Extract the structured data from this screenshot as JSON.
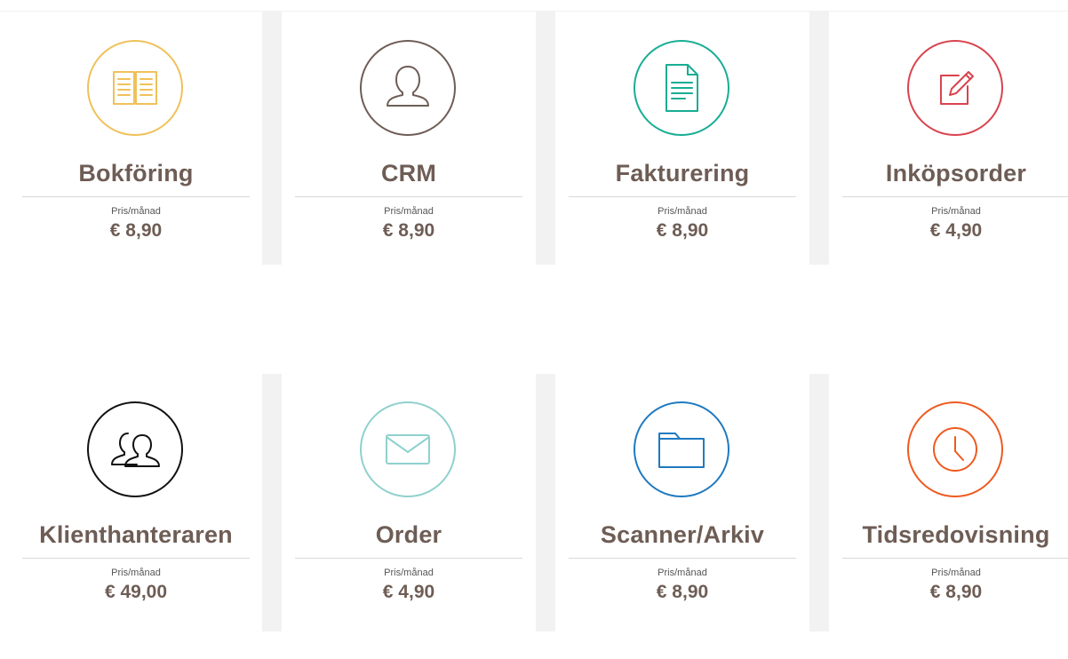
{
  "price_label": "Pris/månad",
  "modules": [
    {
      "name": "Bokföring",
      "price": "€ 8,90",
      "icon": "book-icon",
      "color": "#f0c15a"
    },
    {
      "name": "CRM",
      "price": "€ 8,90",
      "icon": "user-icon",
      "color": "#6e5d55"
    },
    {
      "name": "Fakturering",
      "price": "€ 8,90",
      "icon": "document-icon",
      "color": "#18ad93"
    },
    {
      "name": "Inköpsorder",
      "price": "€ 4,90",
      "icon": "edit-icon",
      "color": "#d9434e"
    },
    {
      "name": "Klienthanteraren",
      "price": "€ 49,00",
      "icon": "users-icon",
      "color": "#111111"
    },
    {
      "name": "Order",
      "price": "€ 4,90",
      "icon": "envelope-icon",
      "color": "#8fd1ce"
    },
    {
      "name": "Scanner/Arkiv",
      "price": "€ 8,90",
      "icon": "folder-icon",
      "color": "#1f7ac0"
    },
    {
      "name": "Tidsredovisning",
      "price": "€ 8,90",
      "icon": "clock-icon",
      "color": "#ee5a1f"
    }
  ]
}
